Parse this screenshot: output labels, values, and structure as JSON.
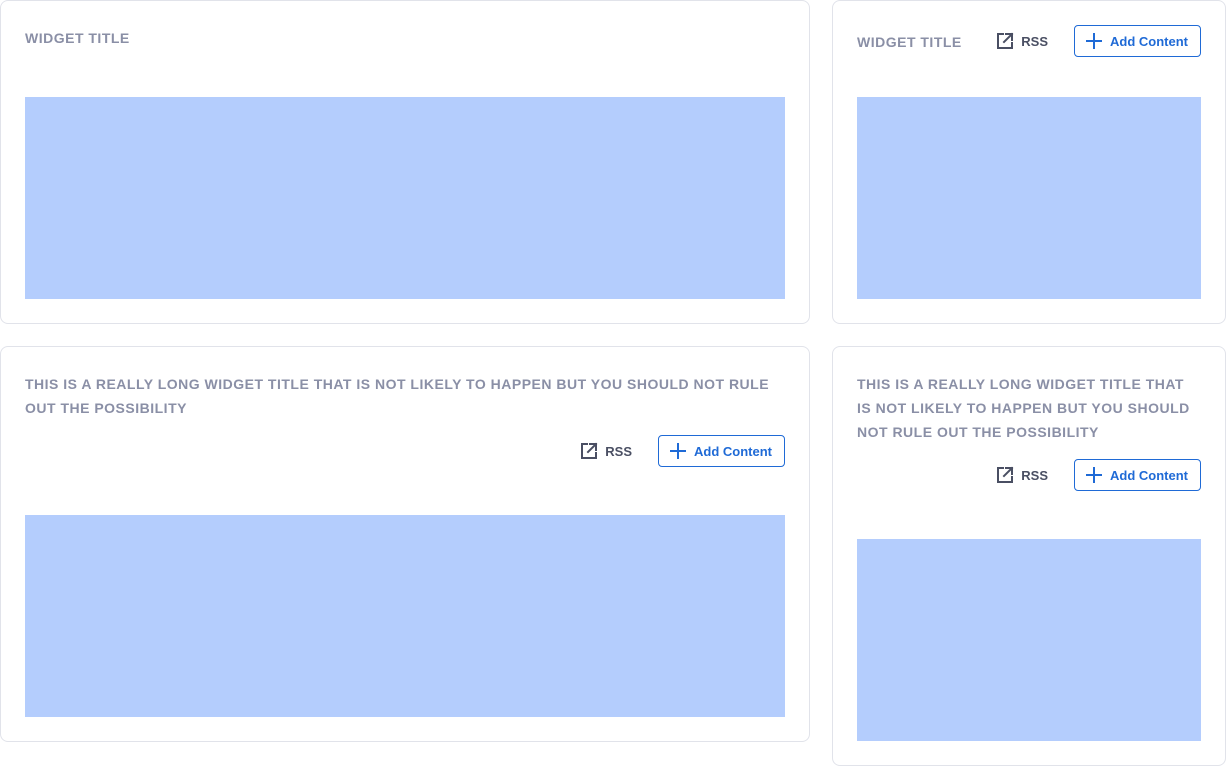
{
  "colors": {
    "title": "#8a8fa6",
    "border": "#e1e3ea",
    "accent": "#1f6ad6",
    "content_placeholder": "#b4cdfd",
    "rss_text": "#4a4f63"
  },
  "widgets": [
    {
      "title": "WIDGET TITLE",
      "show_actions": false
    },
    {
      "title": "WIDGET TITLE",
      "show_actions": true,
      "rss_label": "RSS",
      "rss_icon": "external-link-icon",
      "add_label": "Add Content",
      "add_icon": "plus-icon"
    },
    {
      "title": "THIS IS A REALLY LONG WIDGET TITLE THAT IS NOT LIKELY TO HAPPEN BUT YOU SHOULD NOT RULE OUT THE POSSIBILITY",
      "show_actions": true,
      "rss_label": "RSS",
      "rss_icon": "external-link-icon",
      "add_label": "Add Content",
      "add_icon": "plus-icon"
    },
    {
      "title": "THIS IS A REALLY LONG WIDGET TITLE THAT IS NOT LIKELY TO HAPPEN BUT YOU SHOULD NOT RULE OUT THE POSSIBILITY",
      "show_actions": true,
      "rss_label": "RSS",
      "rss_icon": "external-link-icon",
      "add_label": "Add Content",
      "add_icon": "plus-icon"
    }
  ]
}
